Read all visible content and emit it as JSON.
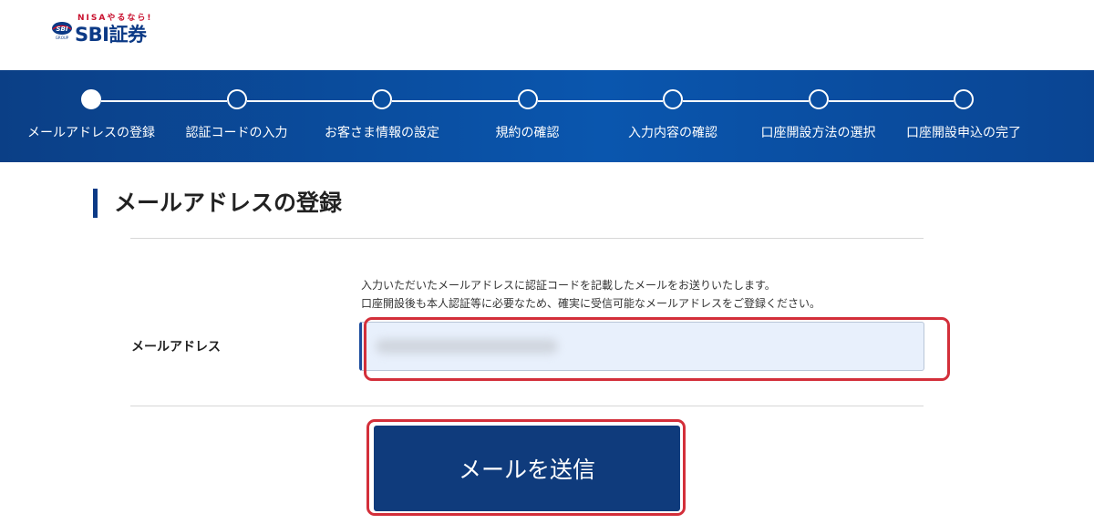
{
  "brand": {
    "tagline": "NISAやるなら!",
    "badge": "SBI",
    "name": "SBI証券",
    "brand_color": "#0c3a86",
    "accent_color": "#c8102e"
  },
  "steps": [
    {
      "label": "メールアドレスの登録",
      "active": true
    },
    {
      "label": "認証コードの入力",
      "active": false
    },
    {
      "label": "お客さま情報の設定",
      "active": false
    },
    {
      "label": "規約の確認",
      "active": false
    },
    {
      "label": "入力内容の確認",
      "active": false
    },
    {
      "label": "口座開設方法の選択",
      "active": false
    },
    {
      "label": "口座開設申込の完了",
      "active": false
    }
  ],
  "page": {
    "title": "メールアドレスの登録"
  },
  "form": {
    "description_line1": "入力いただいたメールアドレスに認証コードを記載したメールをお送りいたします。",
    "description_line2": "口座開設後も本人認証等に必要なため、確実に受信可能なメールアドレスをご登録ください。",
    "email_label": "メールアドレス",
    "email_value": "",
    "submit_label": "メールを送信"
  },
  "colors": {
    "band": "#0a56ae",
    "button": "#0f3b7c",
    "highlight": "#d32f3a",
    "input_bg": "#e8f0fc"
  }
}
